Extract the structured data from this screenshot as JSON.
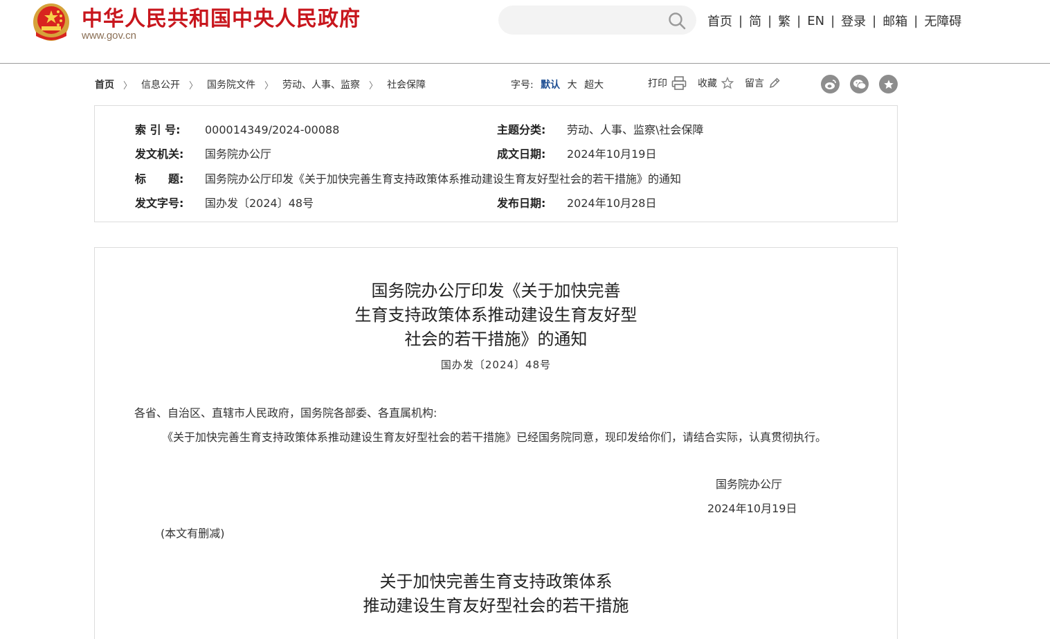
{
  "header": {
    "site_title": "中华人民共和国中央人民政府",
    "site_url": "www.gov.cn",
    "search_placeholder": "",
    "nav": [
      "首页",
      "简",
      "繁",
      "EN",
      "登录",
      "邮箱",
      "无障碍"
    ],
    "brand_red": "#c8161d"
  },
  "breadcrumb": [
    "首页",
    "信息公开",
    "国务院文件",
    "劳动、人事、监察",
    "社会保障"
  ],
  "fontsize": {
    "label": "字号:",
    "options": [
      "默认",
      "大",
      "超大"
    ],
    "active_color": "#1f4f93"
  },
  "tools": {
    "print": "打印",
    "favorite": "收藏",
    "comment": "留言"
  },
  "share": [
    "weibo-icon",
    "wechat-icon",
    "star-icon"
  ],
  "meta": {
    "index_label": "索 引 号:",
    "index_value": "000014349/2024-00088",
    "category_label": "主题分类:",
    "category_value": "劳动、人事、监察\\社会保障",
    "issuer_label": "发文机关:",
    "issuer_value": "国务院办公厅",
    "created_label": "成文日期:",
    "created_value": "2024年10月19日",
    "title_label": "标　　题:",
    "title_value": "国务院办公厅印发《关于加快完善生育支持政策体系推动建设生育友好型社会的若干措施》的通知",
    "docno_label": "发文字号:",
    "docno_value": "国办发〔2024〕48号",
    "published_label": "发布日期:",
    "published_value": "2024年10月28日"
  },
  "article": {
    "title_lines": [
      "国务院办公厅印发《关于加快完善",
      "生育支持政策体系推动建设生育友好型",
      "社会的若干措施》的通知"
    ],
    "doc_number": "国办发〔2024〕48号",
    "addressees": "各省、自治区、直辖市人民政府，国务院各部委、各直属机构:",
    "body": "《关于加快完善生育支持政策体系推动建设生育友好型社会的若干措施》已经国务院同意，现印发给你们，请结合实际，认真贯彻执行。",
    "signature": "国务院办公厅",
    "date": "2024年10月19日",
    "note": "(本文有删减)",
    "subtitle_lines": [
      "关于加快完善生育支持政策体系",
      "推动建设生育友好型社会的若干措施"
    ]
  }
}
